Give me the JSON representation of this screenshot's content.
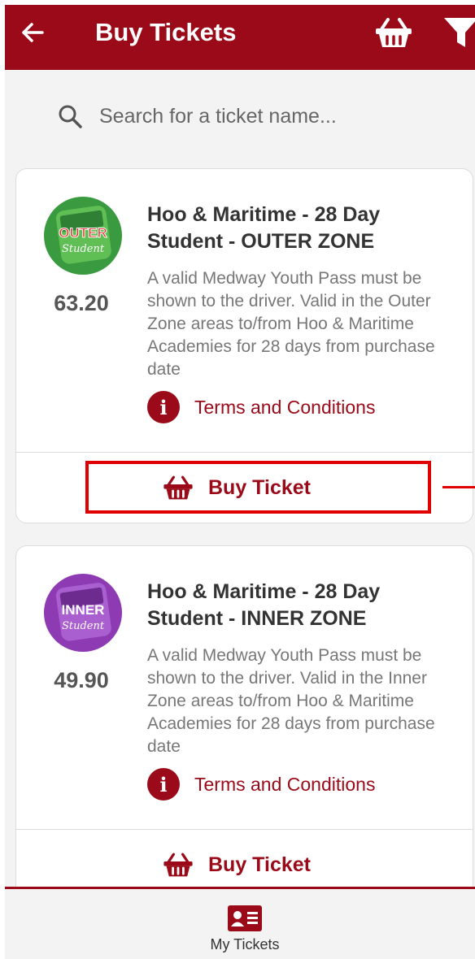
{
  "header": {
    "title": "Buy Tickets",
    "back_icon": "arrow-left-icon",
    "basket_icon": "basket-icon",
    "filter_icon": "filter-icon"
  },
  "search": {
    "placeholder": "Search for a ticket name..."
  },
  "tickets": [
    {
      "logo_text": "OUTER",
      "logo_subtext": "Student",
      "logo_color": "#3a9a3f",
      "price": "63.20",
      "name": "Hoo & Maritime - 28 Day Student - OUTER ZONE",
      "description": "A valid Medway Youth Pass must be shown to the driver. Valid in the Outer Zone areas to/from Hoo & Maritime Academies for 28 days from purchase date",
      "terms_label": "Terms and Conditions",
      "buy_label": "Buy Ticket"
    },
    {
      "logo_text": "INNER",
      "logo_subtext": "Student",
      "logo_color": "#8e3bb3",
      "price": "49.90",
      "name": "Hoo & Maritime - 28 Day Student - INNER ZONE",
      "description": "A valid Medway Youth Pass must be shown to the driver. Valid in the Inner Zone areas to/from Hoo & Maritime Academies for 28 days from purchase date",
      "terms_label": "Terms and Conditions",
      "buy_label": "Buy Ticket"
    }
  ],
  "bottom_nav": {
    "my_tickets_label": "My Tickets"
  },
  "colors": {
    "brand": "#9b0a19",
    "highlight": "#e00000"
  }
}
